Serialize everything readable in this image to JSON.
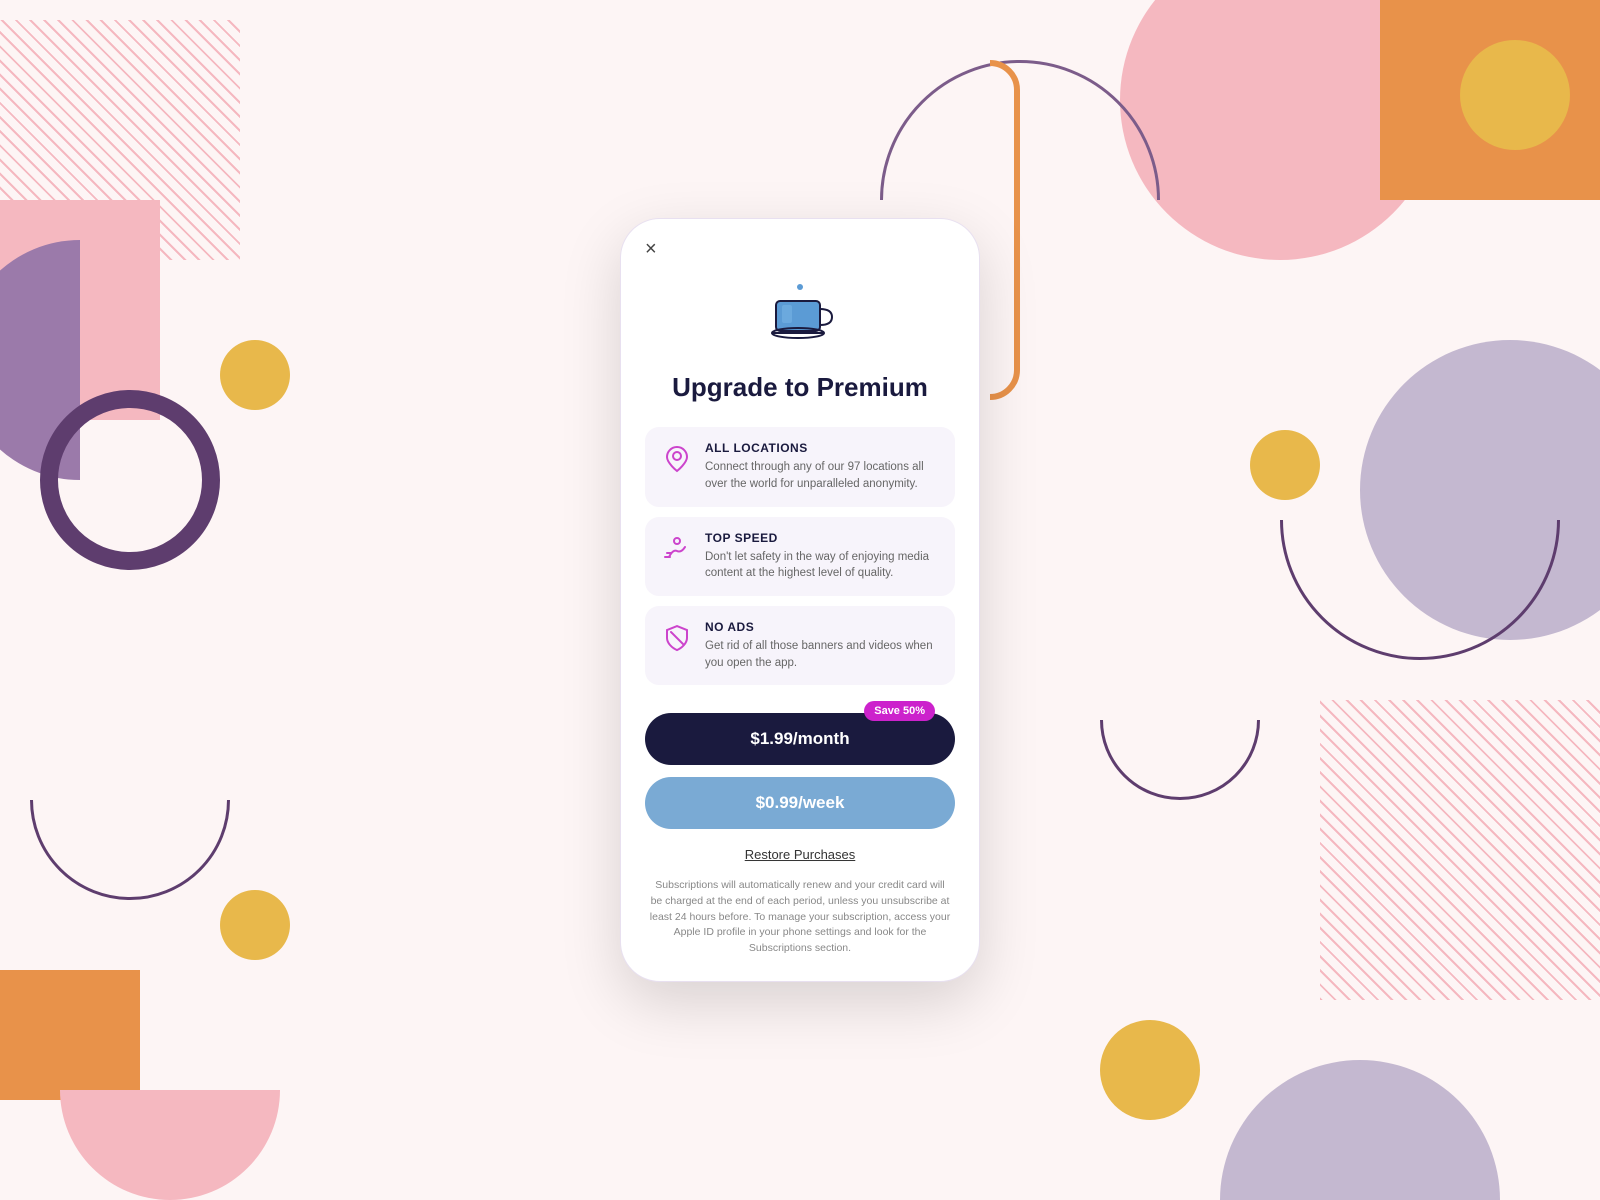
{
  "background": {
    "colors": {
      "page_bg": "#fdf5f5",
      "pink": "#f5b8c0",
      "orange": "#e8924a",
      "gold": "#e8b84b",
      "purple_dark": "#5e3d6e",
      "purple_mid": "#9b7aaa",
      "lavender": "#c4b8d0"
    }
  },
  "modal": {
    "close_label": "×",
    "title": "Upgrade to Premium",
    "features": [
      {
        "id": "locations",
        "title": "ALL LOCATIONS",
        "description": "Connect through any of our 97 locations all over the world for unparalleled anonymity.",
        "icon": "pin"
      },
      {
        "id": "speed",
        "title": "TOP SPEED",
        "description": "Don't let safety in the way of enjoying media content at the highest level of quality.",
        "icon": "speed"
      },
      {
        "id": "no-ads",
        "title": "NO ADS",
        "description": "Get rid of all those banners and videos when you open the app.",
        "icon": "shield-off"
      }
    ],
    "pricing": {
      "monthly": {
        "label": "$1.99/month",
        "badge": "Save 50%"
      },
      "weekly": {
        "label": "$0.99/week"
      }
    },
    "restore_label": "Restore Purchases",
    "disclaimer": "Subscriptions will automatically renew and your credit card will be charged at the end of each period, unless you unsubscribe at least 24 hours before. To manage your subscription, access your Apple ID profile in your phone settings and look for the Subscriptions section."
  }
}
